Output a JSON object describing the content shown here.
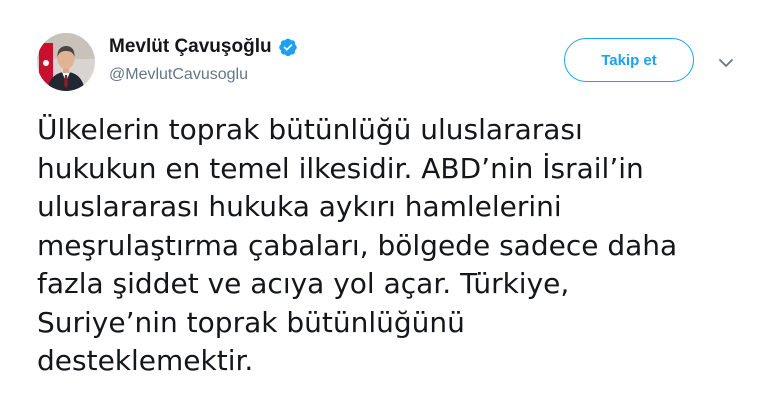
{
  "author": {
    "display_name": "Mevlüt Çavuşoğlu",
    "handle": "@MevlutCavusoglu",
    "verified": true,
    "avatar_icon": "profile-photo"
  },
  "actions": {
    "follow_label": "Takip et",
    "more_icon": "chevron-down-icon"
  },
  "tweet": {
    "lines": [
      "Ülkelerin toprak bütünlüğü uluslararası",
      "hukukun en temel ilkesidir. ABD’nin İsrail’in",
      "uluslararası hukuka aykırı hamlelerini",
      "meşrulaştırma çabaları, bölgede sadece daha",
      "fazla şiddet ve acıya yol açar. Türkiye,",
      "Suriye’nin toprak bütünlüğünü",
      "desteklemektir."
    ]
  },
  "colors": {
    "accent": "#1da1f2",
    "text": "#14171a",
    "secondary_text": "#657786"
  }
}
